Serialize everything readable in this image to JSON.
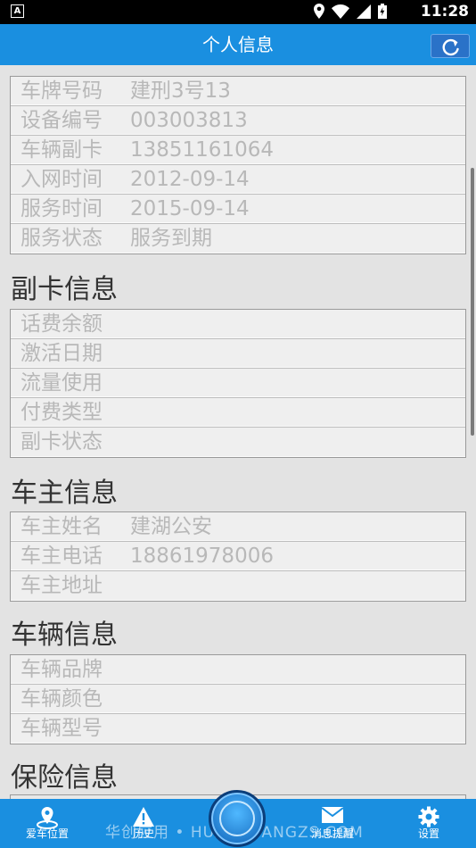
{
  "status_bar": {
    "time": "11:28",
    "notification_letter": "A"
  },
  "header": {
    "title": "个人信息",
    "refresh_icon": "refresh-icon"
  },
  "sections": [
    {
      "title": "",
      "rows": [
        {
          "label": "车牌号码",
          "value": "建刑3号13"
        },
        {
          "label": "设备编号",
          "value": "003003813"
        },
        {
          "label": "车辆副卡",
          "value": "13851161064"
        },
        {
          "label": "入网时间",
          "value": "2012-09-14"
        },
        {
          "label": "服务时间",
          "value": "2015-09-14"
        },
        {
          "label": "服务状态",
          "value": "服务到期"
        }
      ]
    },
    {
      "title": "副卡信息",
      "rows": [
        {
          "label": "话费余额",
          "value": ""
        },
        {
          "label": "激活日期",
          "value": ""
        },
        {
          "label": "流量使用",
          "value": ""
        },
        {
          "label": "付费类型",
          "value": ""
        },
        {
          "label": "副卡状态",
          "value": ""
        }
      ]
    },
    {
      "title": "车主信息",
      "rows": [
        {
          "label": "车主姓名",
          "value": "建湖公安"
        },
        {
          "label": "车主电话",
          "value": "18861978006"
        },
        {
          "label": "车主地址",
          "value": ""
        }
      ]
    },
    {
      "title": "车辆信息",
      "rows": [
        {
          "label": "车辆品牌",
          "value": ""
        },
        {
          "label": "车辆颜色",
          "value": ""
        },
        {
          "label": "车辆型号",
          "value": ""
        }
      ]
    },
    {
      "title": "保险信息",
      "rows": []
    }
  ],
  "tabs": [
    {
      "label": "爱车位置",
      "icon": "location-pin-icon"
    },
    {
      "label": "历史",
      "icon": "warning-icon"
    },
    {
      "label": "消息提醒",
      "icon": "envelope-icon"
    },
    {
      "label": "设置",
      "icon": "gear-icon"
    }
  ],
  "watermark": "华创应用 • HUACHUANGZS.COM",
  "colors": {
    "accent": "#1a8fe0",
    "background": "#e3e3e3"
  }
}
